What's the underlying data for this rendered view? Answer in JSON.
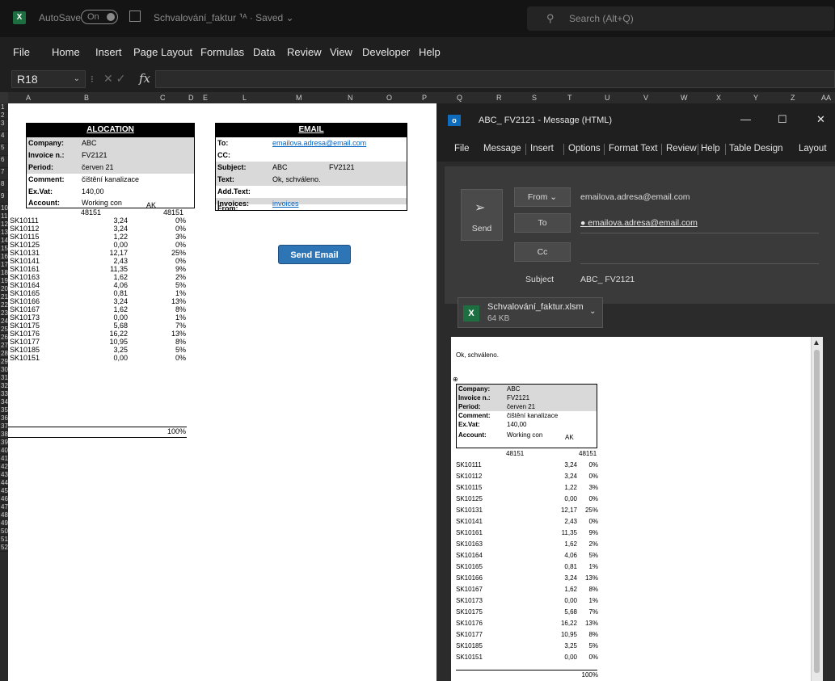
{
  "excel": {
    "autosave_label": "AutoSave",
    "autosave_state": "On",
    "filename": "Schvalování_faktur  ⸣ᴬ  ·  Saved ⌄",
    "search_placeholder": "Search (Alt+Q)",
    "ribbon_tabs": [
      "File",
      "Home",
      "Insert",
      "Page Layout",
      "Formulas",
      "Data",
      "Review",
      "View",
      "Developer",
      "Help"
    ],
    "name_box": "R18",
    "columns": [
      "A",
      "B",
      "C",
      "D",
      "E",
      "L",
      "M",
      "N",
      "O",
      "P",
      "Q",
      "R",
      "S",
      "T",
      "U",
      "V",
      "W",
      "X",
      "Y",
      "Z",
      "AA"
    ],
    "rows": [
      "1",
      "2",
      "3",
      "4",
      "5",
      "6",
      "7",
      "8",
      "9",
      "10",
      "11",
      "12",
      "13",
      "14",
      "15",
      "16",
      "17",
      "18",
      "19",
      "20",
      "21",
      "22",
      "23",
      "24",
      "25",
      "26",
      "27",
      "28",
      "29",
      "30",
      "31",
      "32",
      "33",
      "34",
      "35",
      "36",
      "37",
      "38",
      "39",
      "40",
      "41",
      "42",
      "43",
      "44",
      "45",
      "46",
      "47",
      "48",
      "49",
      "50",
      "51",
      "52"
    ]
  },
  "allocation": {
    "title": "ALOCATION",
    "company_label": "Company:",
    "company": "ABC",
    "invoice_label": "Invoice n.:",
    "invoice": "FV2121",
    "period_label": "Period:",
    "period": "červen 21",
    "comment_label": "Comment:",
    "comment": "čištění kanalizace",
    "exvat_label": "Ex.Vat:",
    "exvat": "140,00",
    "account_label": "Account:",
    "account": "Working con",
    "ak": "AK",
    "acc_num1": "48151",
    "acc_num2": "48151",
    "items": [
      {
        "code": "SK10111",
        "value": "3,24",
        "pct": "0%"
      },
      {
        "code": "SK10112",
        "value": "3,24",
        "pct": "0%"
      },
      {
        "code": "SK10115",
        "value": "1,22",
        "pct": "3%"
      },
      {
        "code": "SK10125",
        "value": "0,00",
        "pct": "0%"
      },
      {
        "code": "SK10131",
        "value": "12,17",
        "pct": "25%"
      },
      {
        "code": "SK10141",
        "value": "2,43",
        "pct": "0%"
      },
      {
        "code": "SK10161",
        "value": "11,35",
        "pct": "9%"
      },
      {
        "code": "SK10163",
        "value": "1,62",
        "pct": "2%"
      },
      {
        "code": "SK10164",
        "value": "4,06",
        "pct": "5%"
      },
      {
        "code": "SK10165",
        "value": "0,81",
        "pct": "1%"
      },
      {
        "code": "SK10166",
        "value": "3,24",
        "pct": "13%"
      },
      {
        "code": "SK10167",
        "value": "1,62",
        "pct": "8%"
      },
      {
        "code": "SK10173",
        "value": "0,00",
        "pct": "1%"
      },
      {
        "code": "SK10175",
        "value": "5,68",
        "pct": "7%"
      },
      {
        "code": "SK10176",
        "value": "16,22",
        "pct": "13%"
      },
      {
        "code": "SK10177",
        "value": "10,95",
        "pct": "8%"
      },
      {
        "code": "SK10185",
        "value": "3,25",
        "pct": "5%"
      },
      {
        "code": "SK10151",
        "value": "0,00",
        "pct": "0%"
      }
    ],
    "total_pct": "100%"
  },
  "email_block": {
    "title": "EMAIL",
    "to_label": "To:",
    "to": "emailova.adresa@email.com",
    "cc_label": "CC:",
    "subject_label": "Subject:",
    "subject_a": "ABC",
    "subject_b": "FV2121",
    "text_label": "Text:",
    "text": "Ok, schváleno.",
    "addtext_label": "Add.Text:",
    "invoices_label": "Invoices:",
    "invoices": "invoices",
    "from_label": "From:",
    "from": "...",
    "send_button": "Send Email"
  },
  "outlook": {
    "window_title": "ABC_ FV2121 - Message (HTML)",
    "menu": [
      "File",
      "Message",
      "Insert",
      "Options",
      "Format Text",
      "Review",
      "Help",
      "Table Design",
      "Layout"
    ],
    "send_label": "Send",
    "from_button": "From ⌄",
    "from_value": "emailova.adresa@email.com",
    "to_button": "To",
    "to_value": "emailova.adresa@email.com",
    "cc_button": "Cc",
    "subject_label": "Subject",
    "subject_value": "ABC_ FV2121",
    "attachment_name": "Schvalování_faktur.xlsm",
    "attachment_size": "64 KB",
    "body_text": "Ok, schváleno."
  }
}
